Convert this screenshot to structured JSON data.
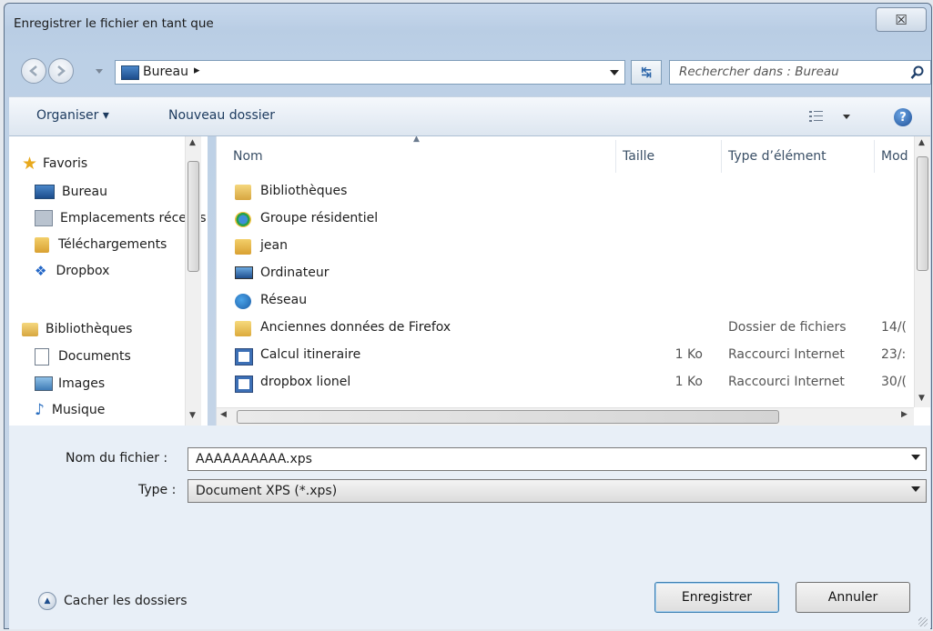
{
  "window": {
    "title": "Enregistrer le fichier en tant que",
    "close": "☒"
  },
  "address": {
    "location": "Bureau",
    "arrow": "▸"
  },
  "search": {
    "placeholder": "Rechercher dans : Bureau"
  },
  "toolbar": {
    "organize": "Organiser ▾",
    "new_folder": "Nouveau dossier",
    "help": "?"
  },
  "nav": {
    "favorites": {
      "label": "Favoris",
      "items": [
        "Bureau",
        "Emplacements récents",
        "Téléchargements",
        "Dropbox"
      ]
    },
    "libraries": {
      "label": "Bibliothèques",
      "items": [
        "Documents",
        "Images",
        "Musique"
      ]
    }
  },
  "columns": {
    "name": "Nom",
    "size": "Taille",
    "type": "Type d’élément",
    "modified": "Modifié le"
  },
  "files": [
    {
      "name": "Bibliothèques",
      "size": "",
      "type": "",
      "date": "",
      "icon": "library-icon"
    },
    {
      "name": "Groupe résidentiel",
      "size": "",
      "type": "",
      "date": "",
      "icon": "homegroup-icon"
    },
    {
      "name": "jean",
      "size": "",
      "type": "",
      "date": "",
      "icon": "user-folder-icon"
    },
    {
      "name": "Ordinateur",
      "size": "",
      "type": "",
      "date": "",
      "icon": "computer-icon"
    },
    {
      "name": "Réseau",
      "size": "",
      "type": "",
      "date": "",
      "icon": "network-icon"
    },
    {
      "name": "Anciennes données de Firefox",
      "size": "",
      "type": "Dossier de fichiers",
      "date": "14/(",
      "icon": "folder-icon"
    },
    {
      "name": "Calcul itineraire",
      "size": "1 Ko",
      "type": "Raccourci Internet",
      "date": "23/:",
      "icon": "internet-shortcut-icon"
    },
    {
      "name": "dropbox lionel",
      "size": "1 Ko",
      "type": "Raccourci Internet",
      "date": "30/(",
      "icon": "internet-shortcut-icon"
    }
  ],
  "form": {
    "filename_label": "Nom du fichier :",
    "filename_value": "AAAAAAAAAA.xps",
    "type_label": "Type :",
    "type_value": "Document XPS (*.xps)"
  },
  "footer": {
    "hide_folders": "Cacher les dossiers",
    "save": "Enregistrer",
    "cancel": "Annuler"
  }
}
